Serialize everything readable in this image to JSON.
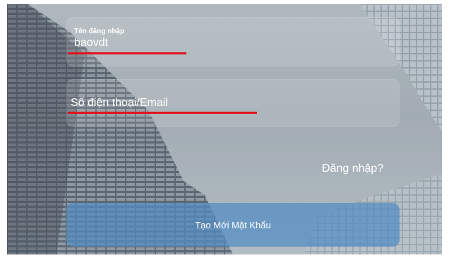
{
  "form": {
    "username_label": "Tên đăng nhập",
    "username_value": "baovdt",
    "contact_placeholder": "Số điện thoại/Email",
    "login_link": "Đăng nhập?",
    "submit_label": "Tạo Mới Mật Khẩu"
  },
  "colors": {
    "background_sky": "#a8b1b9",
    "annotation_red": "#e0131b",
    "button_blue": "#528cc4",
    "text": "#ffffff"
  }
}
